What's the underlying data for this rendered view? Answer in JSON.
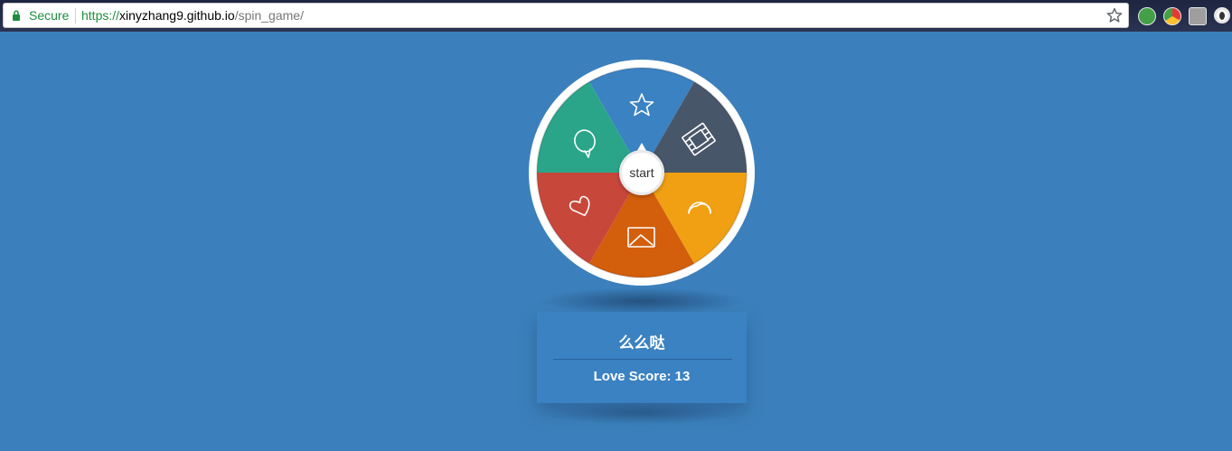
{
  "browser": {
    "secure_label": "Secure",
    "url_scheme": "https://",
    "url_host": "xinyzhang9.github.io",
    "url_path": "/spin_game/",
    "extensions": [
      "green-extension-icon",
      "color-wheel-extension-icon",
      "grey-extension-icon",
      "circle-extension-icon"
    ]
  },
  "wheel": {
    "start_label": "start",
    "segments": [
      {
        "icon": "star-icon",
        "color": "#3a82c2"
      },
      {
        "icon": "film-icon",
        "color": "#48566a"
      },
      {
        "icon": "moon-icon",
        "color": "#f0a012"
      },
      {
        "icon": "picture-icon",
        "color": "#d35e0c"
      },
      {
        "icon": "heart-icon",
        "color": "#c8473b"
      },
      {
        "icon": "speech-bubble-icon",
        "color": "#2aa58a"
      }
    ],
    "rim_color": "#ffffff"
  },
  "result": {
    "title": "么么哒",
    "score_label": "Love Score:",
    "score_value": "13"
  }
}
